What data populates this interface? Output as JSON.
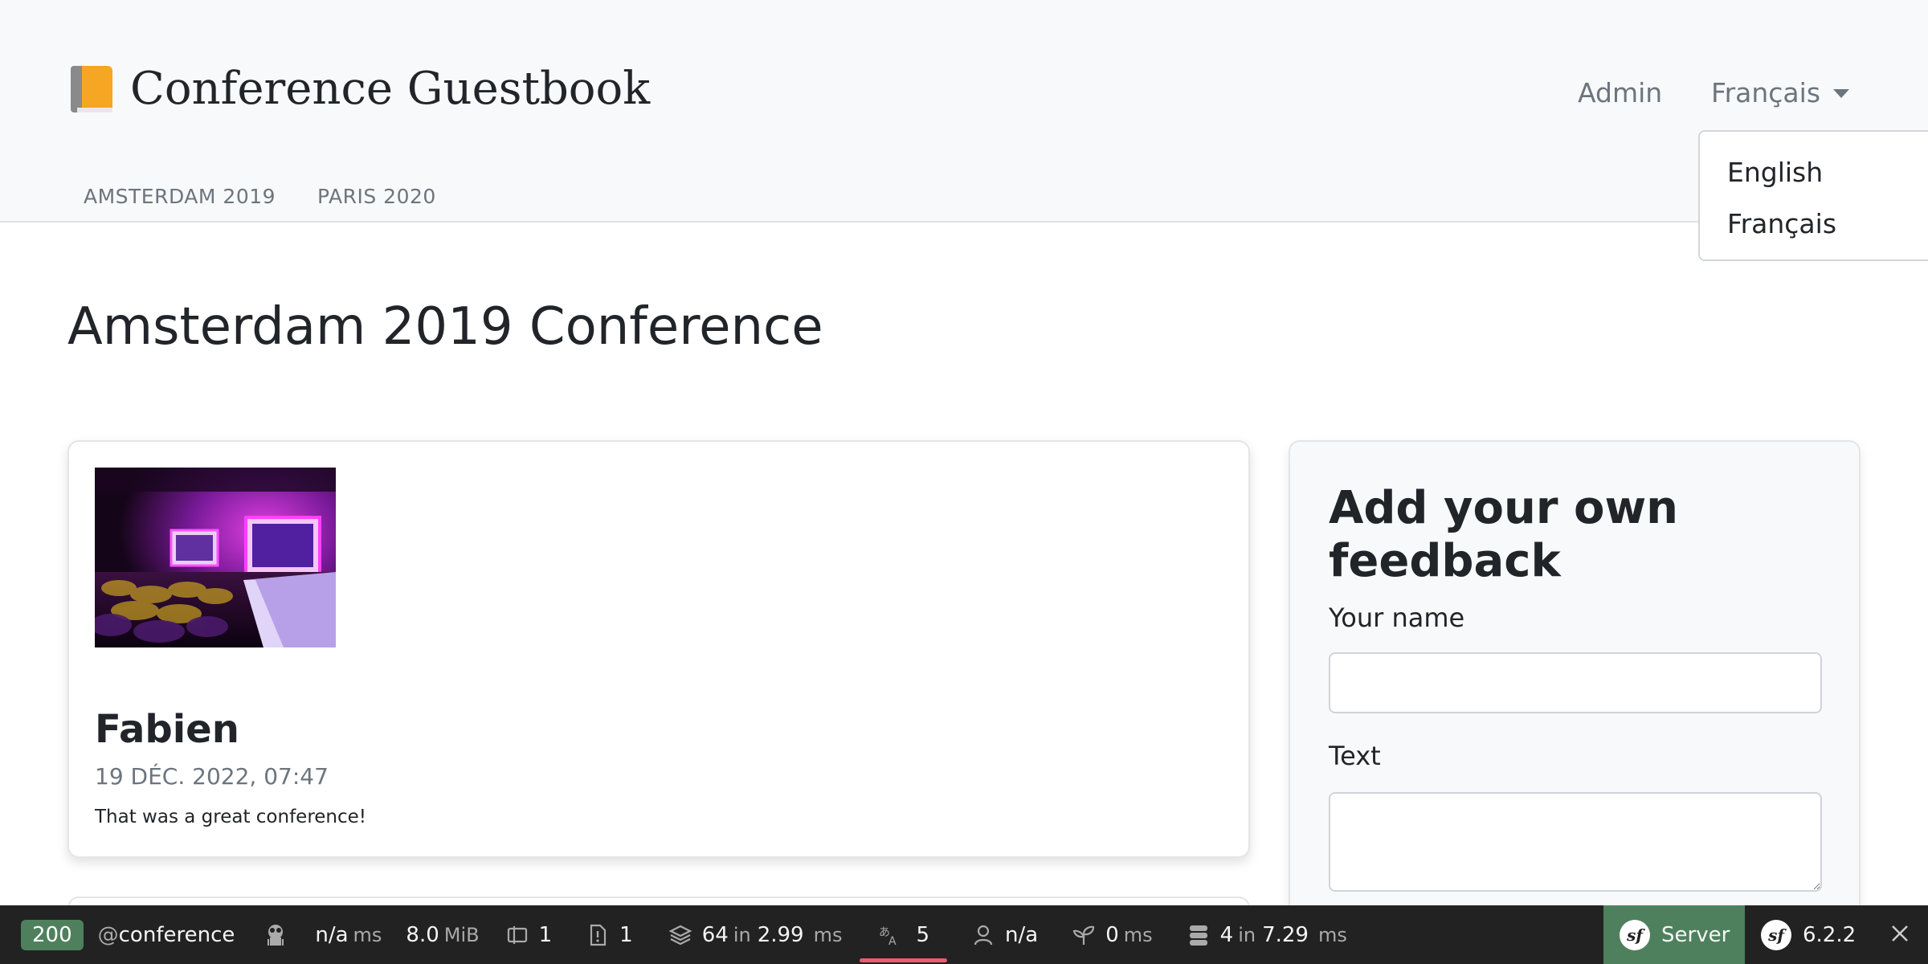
{
  "header": {
    "brand_title": "Conference Guestbook",
    "admin_label": "Admin",
    "language_label": "Français",
    "conferences": [
      "AMSTERDAM 2019",
      "PARIS 2020"
    ]
  },
  "language_dropdown": {
    "options": [
      "English",
      "Français"
    ]
  },
  "main": {
    "page_title": "Amsterdam 2019 Conference",
    "comment": {
      "author": "Fabien",
      "date": "19 DÉC. 2022, 07:47",
      "text": "That was a great conference!"
    },
    "form": {
      "title": "Add your own feedback",
      "name_label": "Your name",
      "text_label": "Text"
    }
  },
  "toolbar": {
    "status_code": "200",
    "route_prefix": "@",
    "route": "conference",
    "time_value": "n/a",
    "time_unit": "ms",
    "memory_value": "8.0",
    "memory_unit": "MiB",
    "forms_count": "1",
    "logs_count": "1",
    "twig_count": "64",
    "twig_in": "in",
    "twig_time": "2.99",
    "twig_unit": "ms",
    "translation_count": "5",
    "security_user": "n/a",
    "events_time": "0",
    "events_unit": "ms",
    "db_count": "4",
    "db_in": "in",
    "db_time": "7.29",
    "db_unit": "ms",
    "server_label": "Server",
    "symfony_version": "6.2.2"
  },
  "colors": {
    "status_ok": "#4f805d",
    "toolbar_bg": "#222222",
    "active_underline": "#ef5b70"
  }
}
